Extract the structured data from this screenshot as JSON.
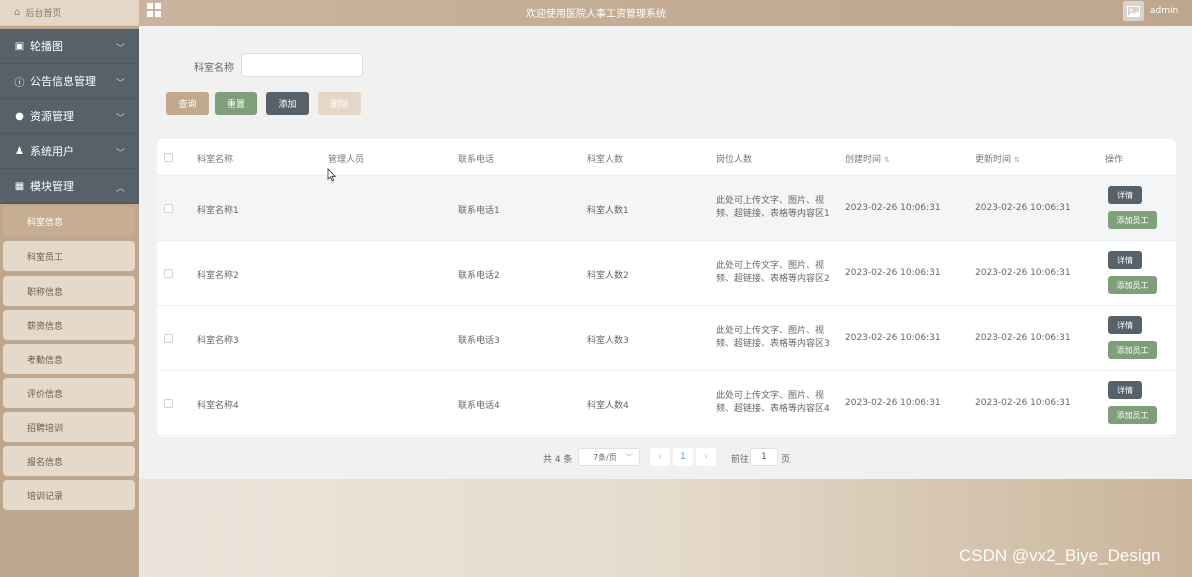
{
  "header": {
    "home_label": "后台首页",
    "title": "欢迎使用医院人事工资管理系统",
    "user": "admin"
  },
  "sidebar": {
    "groups": [
      {
        "label": "轮播图",
        "icon": "image-icon"
      },
      {
        "label": "公告信息管理",
        "icon": "info-icon"
      },
      {
        "label": "资源管理",
        "icon": "location-pin-icon"
      },
      {
        "label": "系统用户",
        "icon": "user-icon"
      },
      {
        "label": "模块管理",
        "icon": "grid-icon"
      }
    ],
    "items": [
      {
        "label": "科室信息",
        "active": true
      },
      {
        "label": "科室员工"
      },
      {
        "label": "职称信息"
      },
      {
        "label": "薪资信息"
      },
      {
        "label": "考勤信息"
      },
      {
        "label": "评价信息"
      },
      {
        "label": "招聘培训"
      },
      {
        "label": "报名信息"
      },
      {
        "label": "培训记录"
      }
    ]
  },
  "search": {
    "label": "科室名称",
    "value": "",
    "buttons": {
      "query": "查询",
      "reset": "重置",
      "add": "添加",
      "delete": "删除"
    }
  },
  "table": {
    "headers": [
      "科室名称",
      "管理人员",
      "联系电话",
      "科室人数",
      "岗位人数",
      "创建时间",
      "更新时间",
      "操作"
    ],
    "rows": [
      {
        "name": "科室名称1",
        "manager": "",
        "phone": "联系电话1",
        "count": "科室人数1",
        "posts_line1": "此处可上传文字、图片、视",
        "posts_line2": "频、超链接、表格等内容区1",
        "created": "2023-02-26 10:06:31",
        "updated": "2023-02-26 10:06:31"
      },
      {
        "name": "科室名称2",
        "manager": "",
        "phone": "联系电话2",
        "count": "科室人数2",
        "posts_line1": "此处可上传文字、图片、视",
        "posts_line2": "频、超链接、表格等内容区2",
        "created": "2023-02-26 10:06:31",
        "updated": "2023-02-26 10:06:31"
      },
      {
        "name": "科室名称3",
        "manager": "",
        "phone": "联系电话3",
        "count": "科室人数3",
        "posts_line1": "此处可上传文字、图片、视",
        "posts_line2": "频、超链接、表格等内容区3",
        "created": "2023-02-26 10:06:31",
        "updated": "2023-02-26 10:06:31"
      },
      {
        "name": "科室名称4",
        "manager": "",
        "phone": "联系电话4",
        "count": "科室人数4",
        "posts_line1": "此处可上传文字、图片、视",
        "posts_line2": "频、超链接、表格等内容区4",
        "created": "2023-02-26 10:06:31",
        "updated": "2023-02-26 10:06:31"
      }
    ],
    "row_actions": {
      "detail": "详情",
      "add_staff": "添加员工"
    }
  },
  "pagination": {
    "total": "共 4 条",
    "page_size": "7条/页",
    "current": "1",
    "goto_label": "前往",
    "goto_value": "1",
    "page_suffix": "页"
  },
  "watermark": "CSDN @vx2_Biye_Design"
}
